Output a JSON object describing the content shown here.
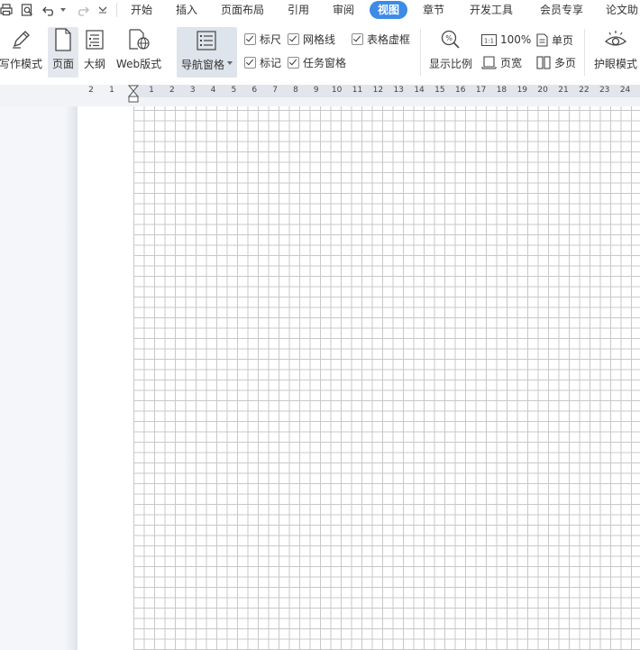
{
  "menu": {
    "tabs": [
      "开始",
      "插入",
      "页面布局",
      "引用",
      "审阅",
      "视图",
      "章节",
      "开发工具",
      "会员专享",
      "论文助"
    ],
    "active_tab": "视图",
    "quick_access_icons": [
      "print-icon",
      "print-preview-icon",
      "undo-icon",
      "undo-dropdown-icon",
      "redo-icon",
      "customize-dropdown-icon"
    ]
  },
  "ribbon": {
    "writing_mode": "写作模式",
    "page_view": "页面",
    "outline": "大纲",
    "web_layout": "Web版式",
    "nav_pane": "导航窗格",
    "checks": {
      "ruler": "标尺",
      "gridlines": "网格线",
      "table_gridlines": "表格虚框",
      "marks": "标记",
      "task_pane": "任务窗格"
    },
    "zoom": "显示比例",
    "zoom_100": "100%",
    "single_page": "单页",
    "page_width": "页宽",
    "multi_page": "多页",
    "eye_protection": "护眼模式"
  },
  "ruler": {
    "left_labels": [
      "2",
      "1"
    ],
    "labels": [
      "1",
      "2",
      "3",
      "4",
      "5",
      "6",
      "7",
      "8",
      "9",
      "10",
      "11",
      "12",
      "13",
      "14",
      "15",
      "16",
      "17",
      "18",
      "19",
      "20",
      "21",
      "22",
      "23",
      "24"
    ]
  }
}
